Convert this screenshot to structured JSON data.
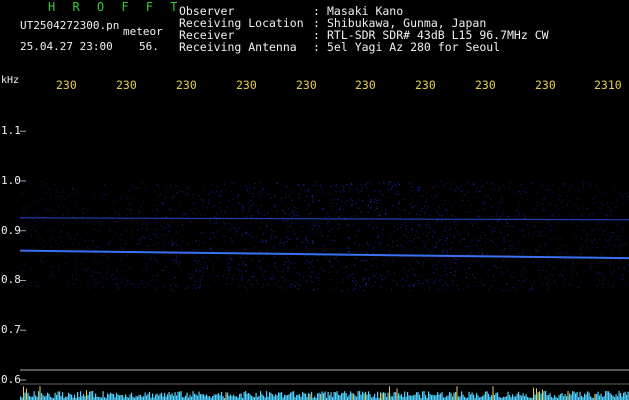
{
  "header": {
    "brand": "H R O F F T",
    "file_name": "UT2504272300.pn",
    "category": "meteor",
    "datetime": "25.04.27 23:00",
    "count": "56."
  },
  "info": [
    {
      "label": "Observer",
      "value": "Masaki Kano"
    },
    {
      "label": "Receiving Location",
      "value": "Shibukawa, Gunma, Japan"
    },
    {
      "label": "Receiver",
      "value": "RTL-SDR SDR# 43dB L15 96.7MHz CW"
    },
    {
      "label": "Receiving Antenna",
      "value": "5el Yagi Az 280 for Seoul"
    }
  ],
  "info_separator": ":",
  "axis": {
    "unit": "kHz",
    "x_ticks": [
      "230",
      "230",
      "230",
      "230",
      "230",
      "230",
      "230",
      "230",
      "230",
      "2310"
    ],
    "y_ticks": [
      "1.1",
      "1.0",
      "0.9",
      "0.8",
      "0.7",
      "0.6"
    ]
  },
  "spectrogram": {
    "type": "heatmap",
    "freq_range_khz": [
      0.6,
      1.12
    ],
    "noise_band_khz": [
      0.78,
      1.0
    ],
    "carrier_lines": [
      {
        "freq_start_khz": 0.86,
        "freq_end_khz": 0.845,
        "color": "#3c78ff"
      },
      {
        "freq_start_khz": 0.926,
        "freq_end_khz": 0.922,
        "color": "#2850e0"
      }
    ],
    "baseline_khz": 0.62,
    "colors": {
      "noise": "#1a32c8",
      "text": "#f0f0f0",
      "tick": "#e6d04a",
      "brand": "#3cc83c",
      "power": "#4fd2ff"
    }
  }
}
